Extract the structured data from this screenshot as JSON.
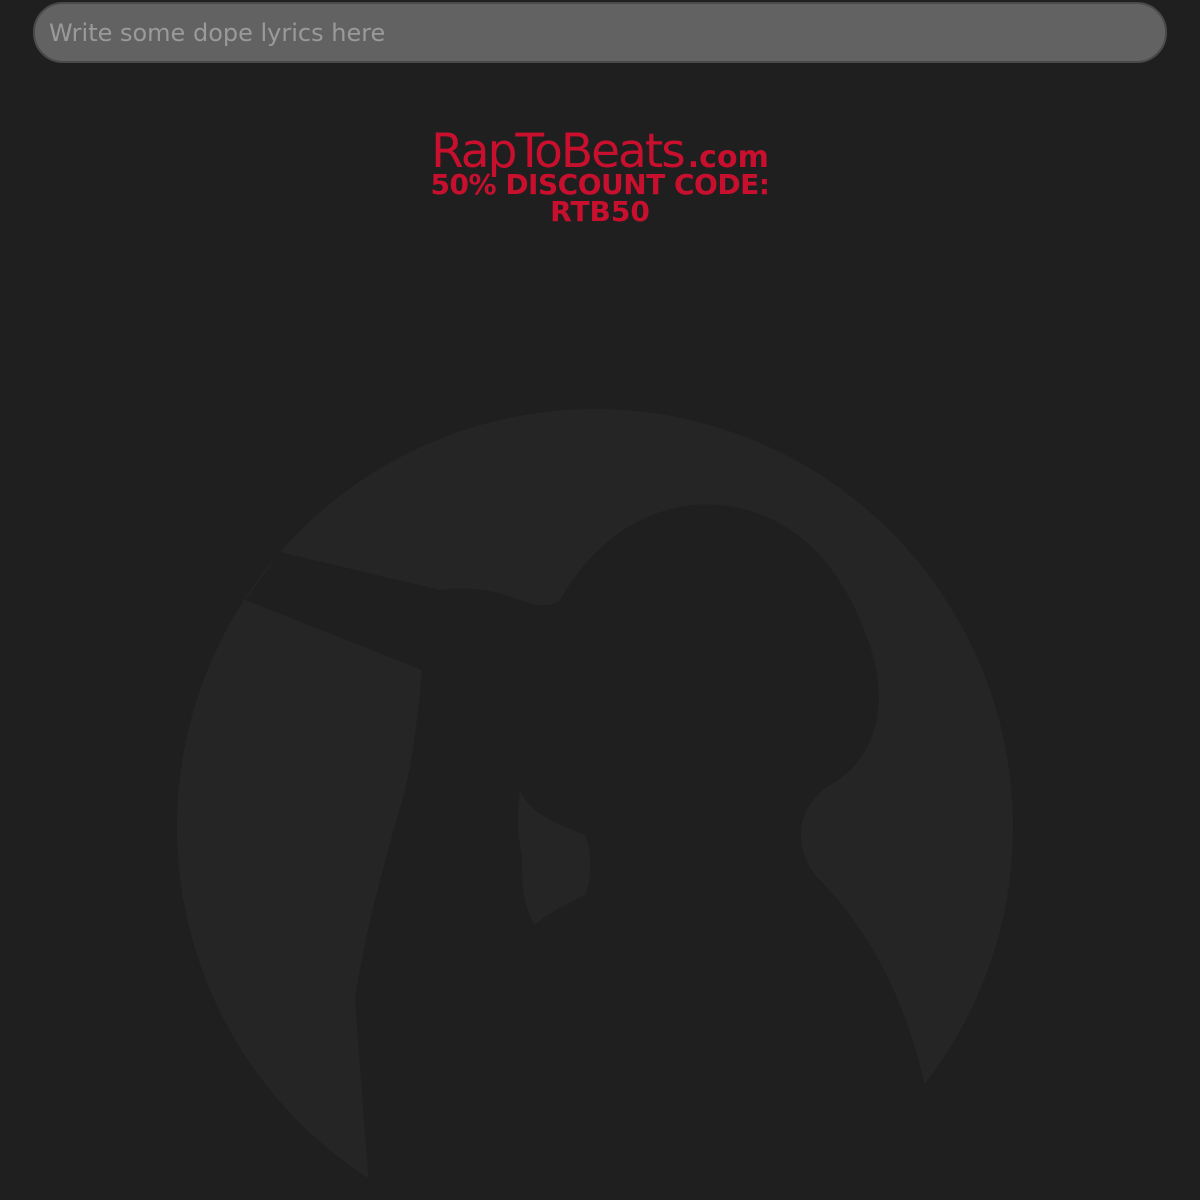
{
  "lyrics_input": {
    "placeholder": "Write some dope lyrics here",
    "value": ""
  },
  "promo": {
    "brand_name": "RapToBeats",
    "brand_domain": ".com",
    "discount_line": "50% DISCOUNT CODE:",
    "code": "RTB50"
  },
  "colors": {
    "background": "#1f1f1f",
    "input_background": "#626262",
    "accent": "#c8102e",
    "watermark_circle": "#262526",
    "watermark_silhouette": "#1f1f1f"
  },
  "background_logo": {
    "icon": "rapper-silhouette-icon"
  }
}
